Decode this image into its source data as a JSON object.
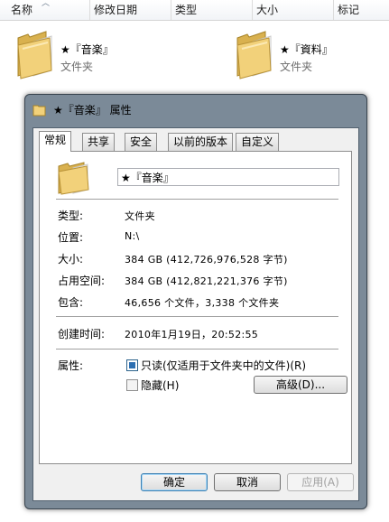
{
  "explorer": {
    "columns": [
      "名称",
      "修改日期",
      "类型",
      "大小",
      "标记"
    ],
    "items": [
      {
        "name": "★『音楽』",
        "type": "文件夹"
      },
      {
        "name": "★『資料』",
        "type": "文件夹"
      }
    ]
  },
  "dialog": {
    "title": "★『音楽』 属性",
    "tabs": [
      "常规",
      "共享",
      "安全",
      "以前的版本",
      "自定义"
    ],
    "active_tab": "常规",
    "name_value": "★『音楽』",
    "props": [
      {
        "label": "类型:",
        "value": "文件夹"
      },
      {
        "label": "位置:",
        "value": "N:\\"
      },
      {
        "label": "大小:",
        "value": "384 GB (412,726,976,528 字节)"
      },
      {
        "label": "占用空间:",
        "value": "384 GB (412,821,221,376 字节)"
      },
      {
        "label": "包含:",
        "value": "46,656 个文件，3,338 个文件夹"
      }
    ],
    "created": {
      "label": "创建时间:",
      "value": "2010年1月19日，20:52:55"
    },
    "attributes": {
      "label": "属性:",
      "readonly": {
        "label": "只读(仅适用于文件夹中的文件)(R)",
        "checked": true
      },
      "hidden": {
        "label": "隐藏(H)",
        "checked": false
      },
      "advanced_button": "高级(D)..."
    },
    "buttons": {
      "ok": "确定",
      "cancel": "取消",
      "apply": "应用(A)"
    }
  },
  "colors": {
    "folder": "#f2d17a",
    "dialog_frame": "#7b8a98",
    "accent": "#3c7fb1"
  }
}
